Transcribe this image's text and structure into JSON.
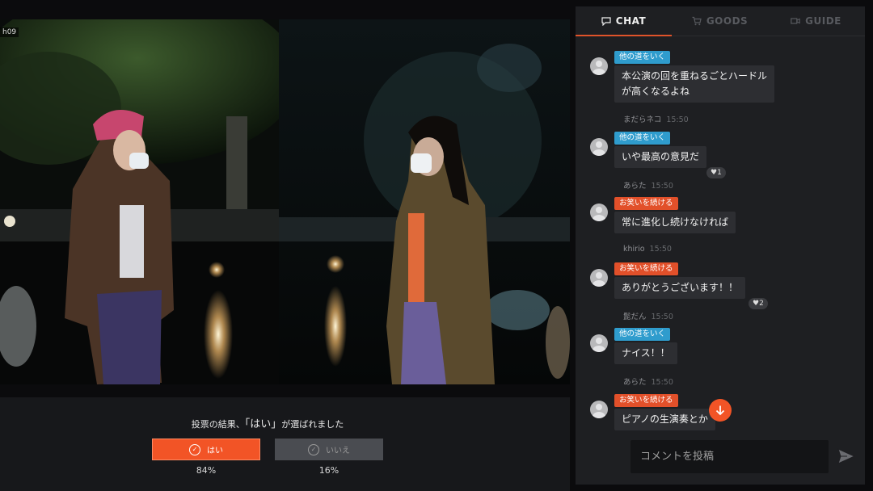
{
  "video": {
    "overlay_id": "h09"
  },
  "vote": {
    "result_prefix": "投票の結果、",
    "result_choice": "「はい」",
    "result_suffix": "が選ばれました",
    "options": [
      {
        "label": "はい",
        "percent": "84%"
      },
      {
        "label": "いいえ",
        "percent": "16%"
      }
    ],
    "colors": {
      "selected": "#f25426",
      "unselected": "#4a4c51"
    }
  },
  "chat_panel": {
    "tabs": [
      {
        "label": "CHAT",
        "icon": "chat-bubble-icon",
        "active": true
      },
      {
        "label": "GOODS",
        "icon": "cart-icon",
        "active": false
      },
      {
        "label": "GUIDE",
        "icon": "video-camera-icon",
        "active": false
      }
    ],
    "accent_color": "#e0532a",
    "messages": [
      {
        "tag": "他の道をいく",
        "tag_color": "#2f9ccd",
        "text_lines": [
          "本公演の回を重ねるごとハードル",
          "が高くなるよね"
        ],
        "user": "まだらネコ",
        "time": "15:50",
        "likes": ""
      },
      {
        "tag": "他の道をいく",
        "tag_color": "#2f9ccd",
        "text_lines": [
          "いや最高の意見だ"
        ],
        "user": "あらた",
        "time": "15:50",
        "likes": "♥1"
      },
      {
        "tag": "お笑いを続ける",
        "tag_color": "#e2502a",
        "text_lines": [
          "常に進化し続けなければ"
        ],
        "user": "khirio",
        "time": "15:50",
        "likes": ""
      },
      {
        "tag": "お笑いを続ける",
        "tag_color": "#e2502a",
        "text_lines": [
          "ありがとうございます！！"
        ],
        "user": "髭だん",
        "time": "15:50",
        "likes": "♥2"
      },
      {
        "tag": "他の道をいく",
        "tag_color": "#2f9ccd",
        "text_lines": [
          "ナイス！！"
        ],
        "user": "あらた",
        "time": "15:50",
        "likes": ""
      },
      {
        "tag": "お笑いを続ける",
        "tag_color": "#e2502a",
        "text_lines": [
          "ピアノの生演奏とか"
        ],
        "user": "",
        "time": "",
        "likes": ""
      }
    ],
    "composer": {
      "placeholder": "コメントを投稿"
    }
  }
}
